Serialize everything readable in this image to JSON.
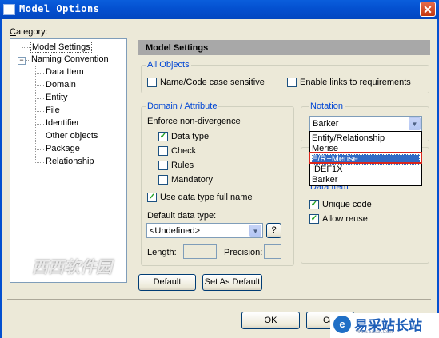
{
  "window": {
    "title": "Model Options",
    "close_glyph": "✕"
  },
  "category": {
    "label_prefix": "C",
    "label_rest": "ategory:",
    "tree": [
      {
        "label": "Model Settings",
        "selected": true
      },
      {
        "label": "Naming Convention",
        "expander": "⊟"
      },
      {
        "label": "Data Item"
      },
      {
        "label": "Domain"
      },
      {
        "label": "Entity"
      },
      {
        "label": "File"
      },
      {
        "label": "Identifier"
      },
      {
        "label": "Other objects"
      },
      {
        "label": "Package"
      },
      {
        "label": "Relationship"
      }
    ]
  },
  "panel": {
    "header": "Model Settings",
    "all_objects": {
      "title": "All Objects",
      "name_code_case": {
        "label": "Name/Code case sensitive",
        "checked": false
      },
      "enable_links": {
        "label": "Enable links to requirements",
        "checked": false
      }
    },
    "domain_attribute": {
      "title": "Domain / Attribute",
      "enforce_label": "Enforce non-divergence",
      "data_type": {
        "label": "Data type",
        "checked": true
      },
      "check": {
        "label": "Check",
        "checked": false
      },
      "rules": {
        "label": "Rules",
        "checked": false
      },
      "mandatory": {
        "label": "Mandatory",
        "checked": false
      },
      "use_full_name": {
        "label": "Use data type full name",
        "checked": true
      },
      "default_type_label": "Default data type:",
      "default_type_value": "<Undefined>",
      "help_glyph": "?",
      "length_label": "Length:",
      "precision_label": "Precision:"
    },
    "notation": {
      "title": "Notation",
      "selected": "Barker",
      "options": [
        "Entity/Relationship",
        "Merise",
        "E/R+Merise",
        "IDEF1X",
        "Barker"
      ],
      "highlighted_index": 2
    },
    "data_item": {
      "title": "Data Item",
      "unique_code": {
        "label": "Unique code",
        "checked": true
      },
      "allow_reuse": {
        "label": "Allow reuse",
        "checked": true
      }
    },
    "default_button": "Default",
    "set_as_default_button": "Set As Default"
  },
  "footer": {
    "ok": "OK",
    "cancel_partial": "Ca"
  },
  "watermarks": {
    "left_text": "西西软件园",
    "right_logo": "e",
    "right_text": "易采站长站",
    "right_sub": "Www.Easck.Com"
  },
  "colors": {
    "titlebar": "#0450d0",
    "group_title": "#0046d5",
    "highlight": "#316ac5",
    "red_box": "#d9261c"
  }
}
